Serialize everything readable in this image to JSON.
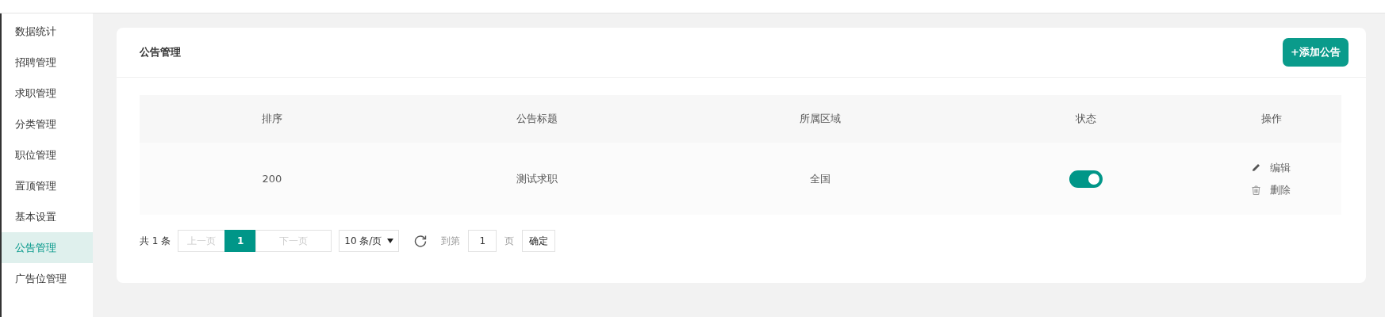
{
  "sidebar": {
    "items": [
      {
        "label": "数据统计",
        "selected": false
      },
      {
        "label": "招聘管理",
        "selected": false
      },
      {
        "label": "求职管理",
        "selected": false
      },
      {
        "label": "分类管理",
        "selected": false
      },
      {
        "label": "职位管理",
        "selected": false
      },
      {
        "label": "置顶管理",
        "selected": false
      },
      {
        "label": "基本设置",
        "selected": false
      },
      {
        "label": "公告管理",
        "selected": true
      },
      {
        "label": "广告位管理",
        "selected": false
      }
    ]
  },
  "card": {
    "title": "公告管理",
    "add_button": "+添加公告"
  },
  "table": {
    "columns": [
      "排序",
      "公告标题",
      "所属区域",
      "状态",
      "操作"
    ],
    "rows": [
      {
        "order": "200",
        "title": "测试求职",
        "region": "全国",
        "status_on": true,
        "actions": [
          {
            "kind": "edit",
            "label": "编辑"
          },
          {
            "kind": "delete",
            "label": "删除"
          }
        ]
      }
    ]
  },
  "pagination": {
    "total": "共 1 条",
    "prev": "上一页",
    "next": "下一页",
    "pages": [
      {
        "label": "1",
        "selected": true
      }
    ],
    "page_size": "10 条/页",
    "goto_label": "到第",
    "goto_value": "1",
    "page_unit": "页",
    "confirm": "确定"
  }
}
